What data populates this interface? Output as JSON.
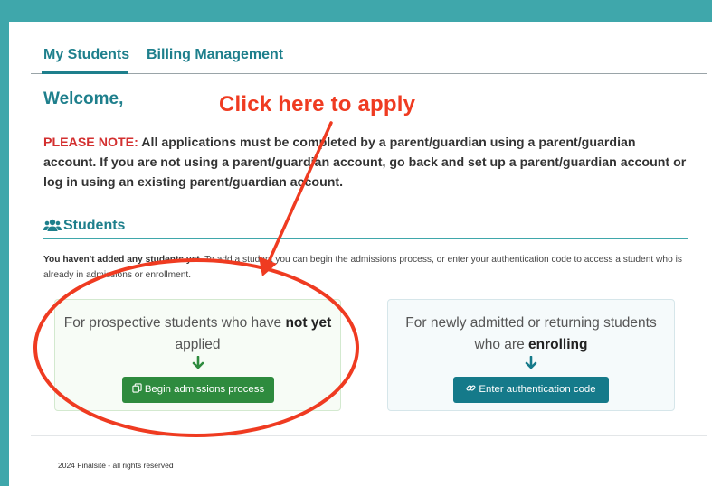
{
  "tabs": [
    {
      "label": "My Students",
      "active": true
    },
    {
      "label": "Billing Management",
      "active": false
    }
  ],
  "welcome": "Welcome,",
  "annotation": {
    "text": "Click here to apply",
    "color": "#ef3b21"
  },
  "note": {
    "label": "PLEASE NOTE:",
    "text": "All applications must be completed by a parent/guardian using a parent/guardian account. If you are not using a parent/guardian account, go back and set up a parent/guardian account or log in using an existing parent/guardian account."
  },
  "students": {
    "icon": "users-icon",
    "title": "Students",
    "info_bold": "You haven't added any students yet.",
    "info_text": "To add a student you can begin the admissions process, or enter your authentication code to access a student who is already in admissions or enrollment."
  },
  "cards": [
    {
      "text_before": "For prospective students who have ",
      "text_bold": "not yet",
      "text_after": " applied",
      "arrow_icon": "arrow-down-icon",
      "button_icon": "copy-icon",
      "button_label": "Begin admissions process",
      "color": "#2e8b3e"
    },
    {
      "text_before": "For newly admitted or returning students who are ",
      "text_bold": "enrolling",
      "text_after": "",
      "arrow_icon": "arrow-down-icon",
      "button_icon": "link-icon",
      "button_label": "Enter authentication code",
      "color": "#157a8a"
    }
  ],
  "footer": "2024 Finalsite - all rights reserved",
  "colors": {
    "frame": "#3fa7ab",
    "accent": "#1e7f8c",
    "alert": "#d32f2f"
  }
}
